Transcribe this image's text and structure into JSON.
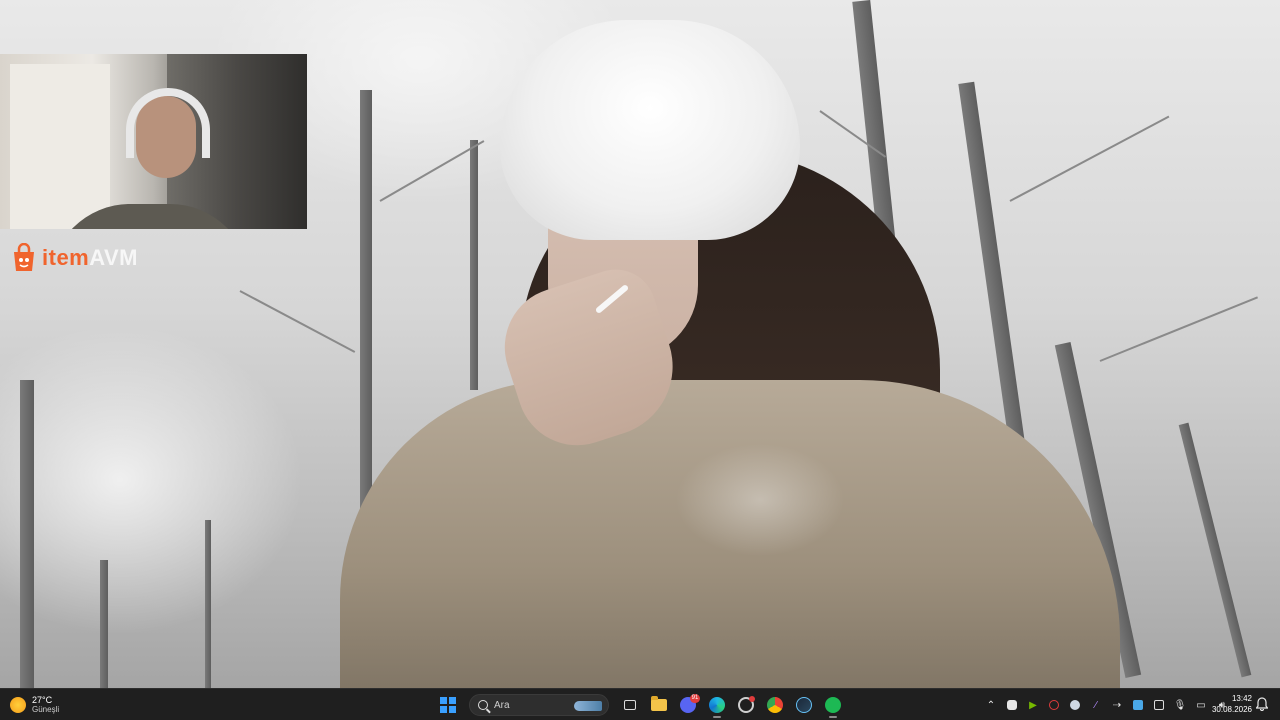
{
  "wallpaper": {
    "description_icon": "wallpaper-image"
  },
  "overlay": {
    "logo": {
      "part1": "item",
      "part2": "AVM",
      "accent": "#f0642d"
    }
  },
  "taskbar": {
    "weather": {
      "temperature": "27°C",
      "condition": "Güneşli"
    },
    "search": {
      "placeholder": "Ara"
    },
    "discord_badge": "91",
    "clock": {
      "time": "13:42",
      "date": "30.08.2026"
    },
    "pinned": [
      "start-icon",
      "search-box",
      "task-view-icon",
      "file-explorer-icon",
      "discord-icon",
      "edge-icon",
      "opera-gx-icon",
      "chrome-icon",
      "steam-icon",
      "spotify-icon"
    ],
    "tray": [
      "chevron-up-icon",
      "discord-tray-icon",
      "nvidia-icon",
      "opera-tray-icon",
      "steam-tray-icon",
      "tray-app-icon",
      "arrow-icon",
      "network-icon",
      "tray-app-icon-2",
      "microphone-icon",
      "display-icon",
      "speaker-icon"
    ]
  }
}
